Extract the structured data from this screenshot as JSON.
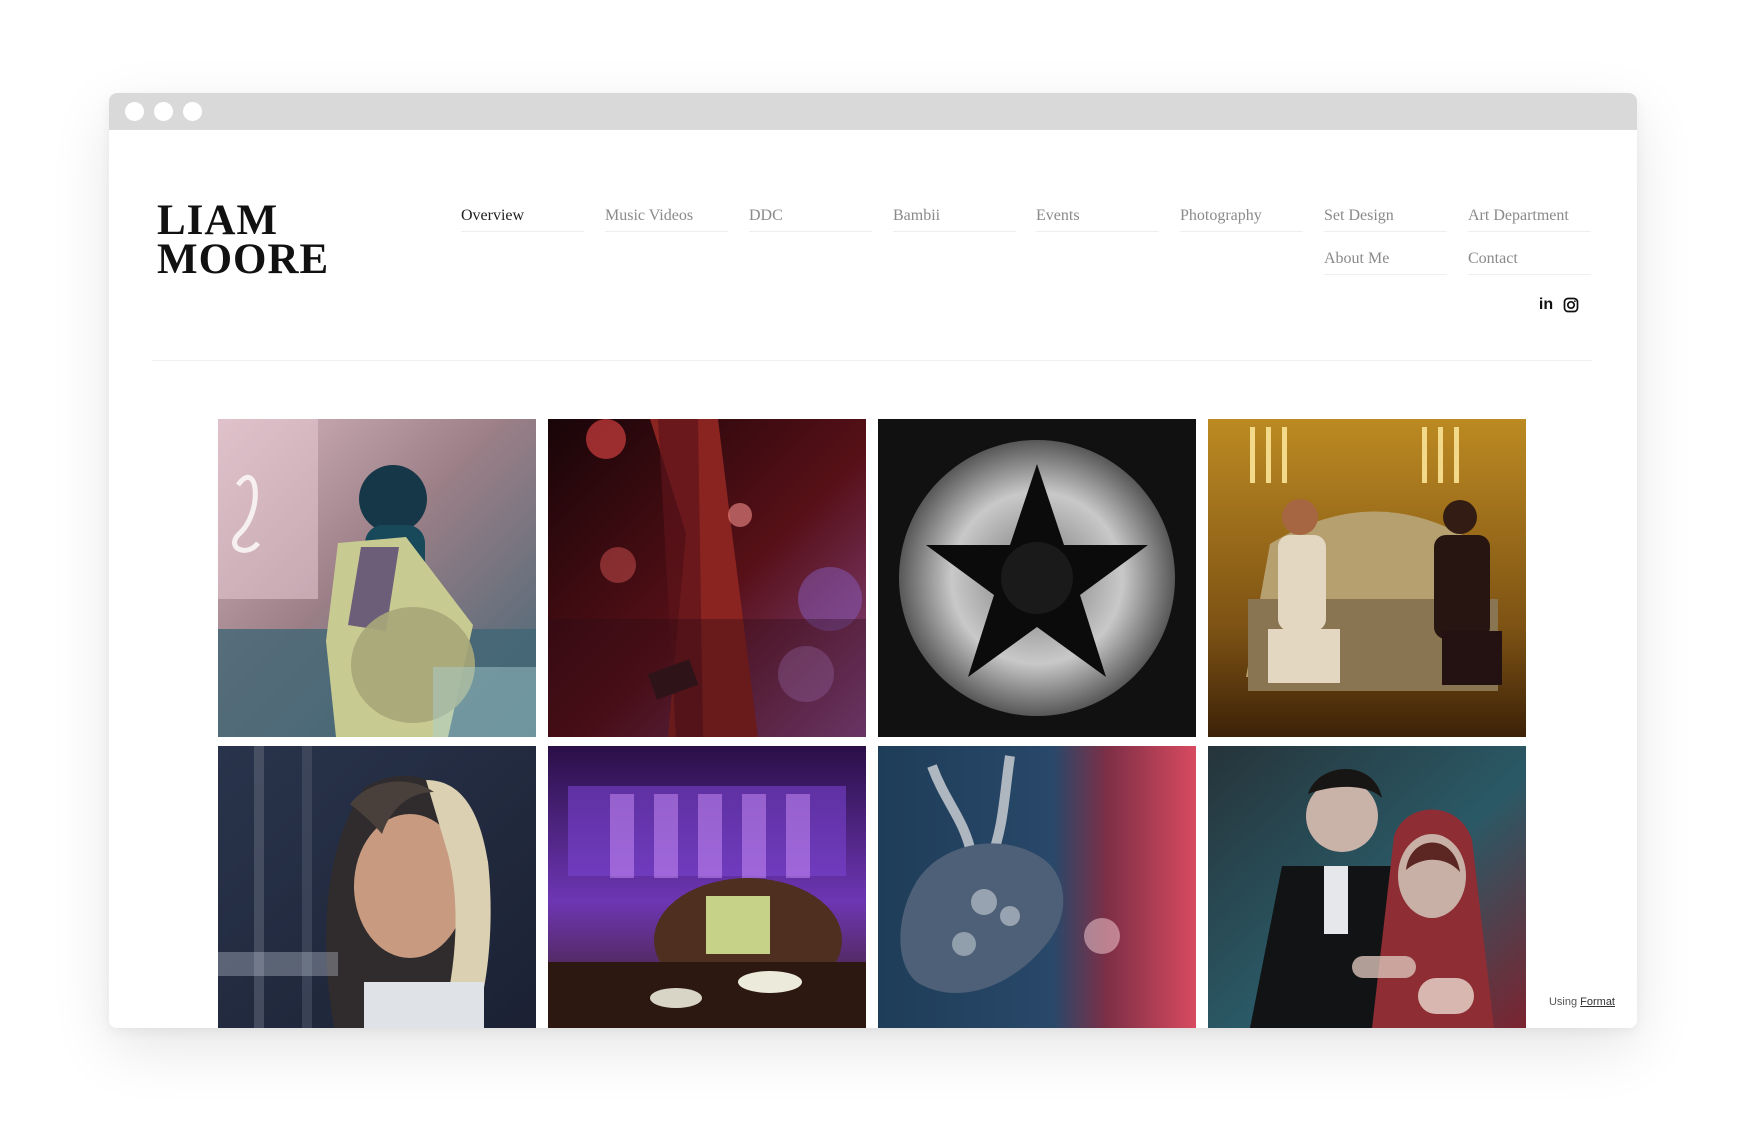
{
  "brand": {
    "line1": "LIAM",
    "line2": "MOORE"
  },
  "nav": {
    "items": [
      {
        "label": "Overview",
        "active": true
      },
      {
        "label": "Music Videos",
        "active": false
      },
      {
        "label": "DDC",
        "active": false
      },
      {
        "label": "Bambii",
        "active": false
      },
      {
        "label": "Events",
        "active": false
      },
      {
        "label": "Photography",
        "active": false
      },
      {
        "label": "Set Design",
        "active": false
      },
      {
        "label": "Art Department",
        "active": false
      },
      {
        "label": "About Me",
        "active": false
      },
      {
        "label": "Contact",
        "active": false
      }
    ]
  },
  "social": {
    "linkedin_icon": "linkedin-icon",
    "instagram_icon": "instagram-icon",
    "linkedin_glyph": "in"
  },
  "gallery": {
    "items": [
      {
        "name": "gallery-image-pink-room-portrait"
      },
      {
        "name": "gallery-image-red-tree-club"
      },
      {
        "name": "gallery-image-black-star-lights"
      },
      {
        "name": "gallery-image-gold-sofa-scene"
      },
      {
        "name": "gallery-image-blue-portrait"
      },
      {
        "name": "gallery-image-purple-bar"
      },
      {
        "name": "gallery-image-mask-red-blue"
      },
      {
        "name": "gallery-image-couple-red-cloak"
      }
    ]
  },
  "footer": {
    "using_label": "Using",
    "format_link": "Format"
  },
  "colors": {
    "window_bar": "#d9d9d9",
    "nav_active": "#1e1e1e",
    "nav_inactive": "#8a8a8a",
    "brand_text": "#111111"
  }
}
